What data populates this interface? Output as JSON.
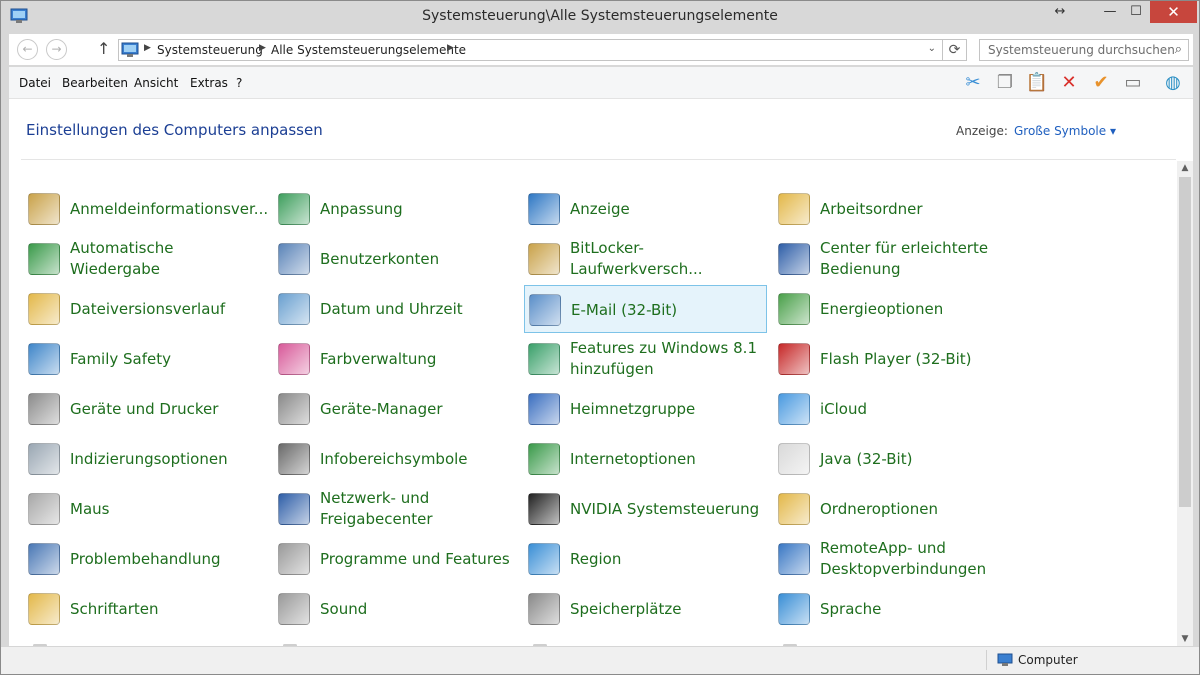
{
  "window": {
    "title": "Systemsteuerung\\Alle Systemsteuerungselemente",
    "controls": {
      "arrows": "↔",
      "minimize": "—",
      "maximize": "☐",
      "close": "✕"
    }
  },
  "nav": {
    "back": "←",
    "forward": "→",
    "up": "↑",
    "breadcrumb": [
      "Systemsteuerung",
      "Alle Systemsteuerungselemente"
    ],
    "refresh": "⟳",
    "search_placeholder": "Systemsteuerung durchsuchen"
  },
  "menu": [
    "Datei",
    "Bearbeiten",
    "Ansicht",
    "Extras",
    "?"
  ],
  "toolbar": [
    {
      "icon": "scissors-icon",
      "glyph": "✂",
      "color": "#3a8fd6"
    },
    {
      "icon": "copy-icon",
      "glyph": "❐",
      "color": "#8a8a8a"
    },
    {
      "icon": "paste-icon",
      "glyph": "📋",
      "color": "#c79a3a"
    },
    {
      "icon": "delete-icon",
      "glyph": "✕",
      "color": "#d9302b"
    },
    {
      "icon": "checkmark-icon",
      "glyph": "✔",
      "color": "#e8922c"
    },
    {
      "icon": "properties-icon",
      "glyph": "▭",
      "color": "#7a7a7a"
    },
    {
      "icon": "globe-icon",
      "glyph": "◍",
      "color": "#2a8fc4"
    }
  ],
  "header": {
    "title": "Einstellungen des Computers anpassen",
    "view_label": "Anzeige:",
    "view_value": "Große Symbole ▾"
  },
  "items": [
    [
      {
        "label": "Anmeldeinformationsver...",
        "icon": "vault-icon",
        "color": "#c9a24a"
      },
      {
        "label": "Automatische Wiedergabe",
        "icon": "autoplay-icon",
        "color": "#3a9a4a"
      },
      {
        "label": "Dateiversionsverlauf",
        "icon": "folder-history-icon",
        "color": "#e3b84a"
      },
      {
        "label": "Family Safety",
        "icon": "family-icon",
        "color": "#3f86c9"
      },
      {
        "label": "Geräte und Drucker",
        "icon": "printer-icon",
        "color": "#8c8c8c"
      },
      {
        "label": "Indizierungsoptionen",
        "icon": "magnifier-icon",
        "color": "#9aa7b3"
      },
      {
        "label": "Maus",
        "icon": "mouse-icon",
        "color": "#a8a8a8"
      },
      {
        "label": "Problembehandlung",
        "icon": "troubleshoot-icon",
        "color": "#4a78b5"
      },
      {
        "label": "Schriftarten",
        "icon": "fonts-folder-icon",
        "color": "#e3b84a"
      }
    ],
    [
      {
        "label": "Anpassung",
        "icon": "personalize-icon",
        "color": "#3f9f5e"
      },
      {
        "label": "Benutzerkonten",
        "icon": "users-icon",
        "color": "#5b84b8"
      },
      {
        "label": "Datum und Uhrzeit",
        "icon": "clock-icon",
        "color": "#6aa0d0"
      },
      {
        "label": "Farbverwaltung",
        "icon": "color-icon",
        "color": "#d85b9a"
      },
      {
        "label": "Geräte-Manager",
        "icon": "device-manager-icon",
        "color": "#8a8a8a"
      },
      {
        "label": "Infobereichsymbole",
        "icon": "tray-icon",
        "color": "#6a6a6a"
      },
      {
        "label": "Netzwerk- und\nFreigabecenter",
        "icon": "network-icon",
        "color": "#2f5fa8"
      },
      {
        "label": "Programme und Features",
        "icon": "programs-icon",
        "color": "#9a9a9a"
      },
      {
        "label": "Sound",
        "icon": "speaker-icon",
        "color": "#9a9a9a"
      }
    ],
    [
      {
        "label": "Anzeige",
        "icon": "display-icon",
        "color": "#2f78c4"
      },
      {
        "label": "BitLocker-Laufwerkversch...",
        "icon": "bitlocker-icon",
        "color": "#c9a24a"
      },
      {
        "label": "E-Mail (32-Bit)",
        "icon": "mail-icon",
        "color": "#5b8fc9"
      },
      {
        "label": "Features zu Windows 8.1\nhinzufügen",
        "icon": "features-icon",
        "color": "#3aa06a"
      },
      {
        "label": "Heimnetzgruppe",
        "icon": "homegroup-icon",
        "color": "#3b6fc0"
      },
      {
        "label": "Internetoptionen",
        "icon": "internet-icon",
        "color": "#3a9a4a"
      },
      {
        "label": "NVIDIA Systemsteuerung",
        "icon": "nvidia-icon",
        "color": "#222222"
      },
      {
        "label": "Region",
        "icon": "region-icon",
        "color": "#3a8fd6"
      },
      {
        "label": "Speicherplätze",
        "icon": "storage-icon",
        "color": "#8a8a8a"
      }
    ],
    [
      {
        "label": "Arbeitsordner",
        "icon": "work-folder-icon",
        "color": "#e3b84a"
      },
      {
        "label": "Center für erleichterte\nBedienung",
        "icon": "ease-of-access-icon",
        "color": "#2f5fa8"
      },
      {
        "label": "Energieoptionen",
        "icon": "power-icon",
        "color": "#4aa04a"
      },
      {
        "label": "Flash Player (32-Bit)",
        "icon": "flash-icon",
        "color": "#c62828"
      },
      {
        "label": "iCloud",
        "icon": "cloud-icon",
        "color": "#4a9ae0"
      },
      {
        "label": "Java (32-Bit)",
        "icon": "java-icon",
        "color": "#d9d9d9"
      },
      {
        "label": "Ordneroptionen",
        "icon": "folder-options-icon",
        "color": "#e3b84a"
      },
      {
        "label": "RemoteApp- und\nDesktopverbindungen",
        "icon": "remoteapp-icon",
        "color": "#3a78c4"
      },
      {
        "label": "Sprache",
        "icon": "language-icon",
        "color": "#3a8fd6"
      }
    ]
  ],
  "selected": {
    "column": 2,
    "row": 2
  },
  "status": {
    "location": "Computer"
  }
}
